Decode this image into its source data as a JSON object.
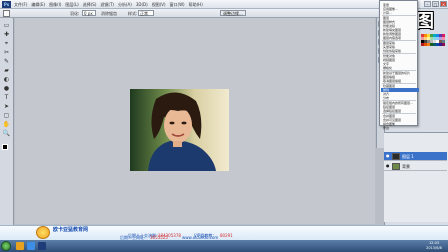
{
  "menubar": {
    "app_logo": "Ps",
    "items": [
      "文件(F)",
      "编辑(E)",
      "图像(I)",
      "图层(L)",
      "选择(S)",
      "滤镜(T)",
      "分析(A)",
      "3D(D)",
      "视图(V)",
      "窗口(W)",
      "帮助(H)"
    ]
  },
  "window_controls": [
    "–",
    "□",
    "×"
  ],
  "options": {
    "label_size": "羽化:",
    "size_value": "0 px",
    "check_label": "消除锯齿",
    "style_label": "样式:",
    "style_value": "正常",
    "refine_button": "调整边缘..."
  },
  "tools": [
    "▭",
    "✚",
    "⌖",
    "✂",
    "✎",
    "▰",
    "◐",
    "●",
    "T",
    "➤",
    "▢",
    "✋",
    "🔍"
  ],
  "overlay": {
    "title": "抠图"
  },
  "context_menu": {
    "items": [
      {
        "label": "变量",
        "hl": false
      },
      {
        "label": "应用图像...",
        "hl": false
      },
      {
        "label": "计算...",
        "hl": false
      },
      {
        "label": "图层",
        "hl": false
      },
      {
        "label": "图层样式",
        "hl": false
      },
      {
        "label": "智能滤镜",
        "hl": false
      },
      {
        "label": "新建填充图层",
        "hl": false
      },
      {
        "label": "新建调整图层",
        "hl": false
      },
      {
        "label": "图层内容选项",
        "hl": false
      },
      {
        "label": "图层蒙版",
        "hl": false
      },
      {
        "label": "矢量蒙版",
        "hl": false
      },
      {
        "label": "创建剪贴蒙版",
        "hl": false
      },
      {
        "label": "智能对象",
        "hl": false
      },
      {
        "label": "视频图层",
        "hl": false
      },
      {
        "label": "文字",
        "hl": false
      },
      {
        "label": "栅格化",
        "hl": false
      },
      {
        "label": "新建基于图层的切片",
        "hl": false
      },
      {
        "label": "图层编组",
        "hl": false
      },
      {
        "label": "取消图层编组",
        "hl": false
      },
      {
        "label": "隐藏图层",
        "hl": false
      },
      {
        "label": "排列",
        "hl": true
      },
      {
        "label": "对齐",
        "hl": false
      },
      {
        "label": "分布",
        "hl": false
      },
      {
        "label": "锁定组内的所有图层...",
        "hl": false
      },
      {
        "label": "链接图层",
        "hl": false
      },
      {
        "label": "选择链接图层",
        "hl": false
      },
      {
        "label": "合并图层",
        "hl": false
      },
      {
        "label": "合并可见图层",
        "hl": false
      },
      {
        "label": "拼合图像",
        "hl": false
      },
      {
        "label": "修边",
        "hl": false
      }
    ]
  },
  "layers": {
    "rows": [
      {
        "name": "图层 1",
        "selected": true
      },
      {
        "name": "背景",
        "selected": false
      }
    ]
  },
  "footer": {
    "brand": "欧卡亚猛教育网",
    "qq_label": "后期人士交流群：",
    "qq_number": "184305378",
    "vip_label": "VIP群教教：",
    "vip_number": "80291",
    "site_label": "后期人士网址：",
    "site_number": "3655525",
    "site_url": "www.okaiedu.com"
  },
  "taskbar": {
    "time": "12:03",
    "date": "2013/6/8"
  },
  "colors": {
    "accent": "#3a72c9",
    "footer_text": "#1a4fb0",
    "footer_number": "#d32a2a"
  }
}
